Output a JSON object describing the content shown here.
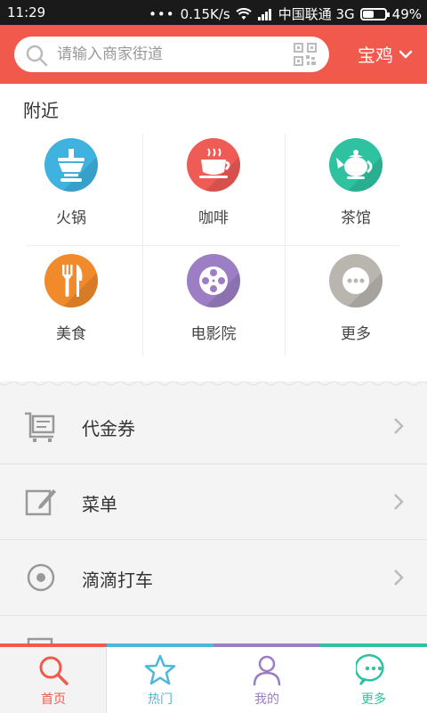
{
  "status_bar": {
    "time": "11:29",
    "speed": "0.15K/s",
    "carrier": "中国联通 3G",
    "battery": "49%"
  },
  "header": {
    "search_placeholder": "请输入商家街道",
    "city": "宝鸡",
    "accent_color": "#f0594c"
  },
  "nearby": {
    "title": "附近",
    "items": [
      {
        "label": "火锅",
        "icon": "hotpot-icon",
        "color": "#3fb2e0"
      },
      {
        "label": "咖啡",
        "icon": "coffee-icon",
        "color": "#ef5b55"
      },
      {
        "label": "茶馆",
        "icon": "teapot-icon",
        "color": "#2ec2a0"
      },
      {
        "label": "美食",
        "icon": "cutlery-icon",
        "color": "#f08a2a"
      },
      {
        "label": "电影院",
        "icon": "film-reel-icon",
        "color": "#9b7ec4"
      },
      {
        "label": "更多",
        "icon": "more-icon",
        "color": "#b9b6b0"
      }
    ]
  },
  "menu": {
    "items": [
      {
        "label": "代金券",
        "icon": "cart-icon"
      },
      {
        "label": "菜单",
        "icon": "edit-icon"
      },
      {
        "label": "滴滴打车",
        "icon": "target-icon"
      }
    ]
  },
  "tabbar": {
    "tabs": [
      {
        "label": "首页",
        "icon": "search-icon",
        "color": "#f0594c"
      },
      {
        "label": "热门",
        "icon": "star-icon",
        "color": "#4cb8db"
      },
      {
        "label": "我的",
        "icon": "person-icon",
        "color": "#9b7ec4"
      },
      {
        "label": "更多",
        "icon": "chat-more-icon",
        "color": "#2ec2a0"
      }
    ]
  }
}
